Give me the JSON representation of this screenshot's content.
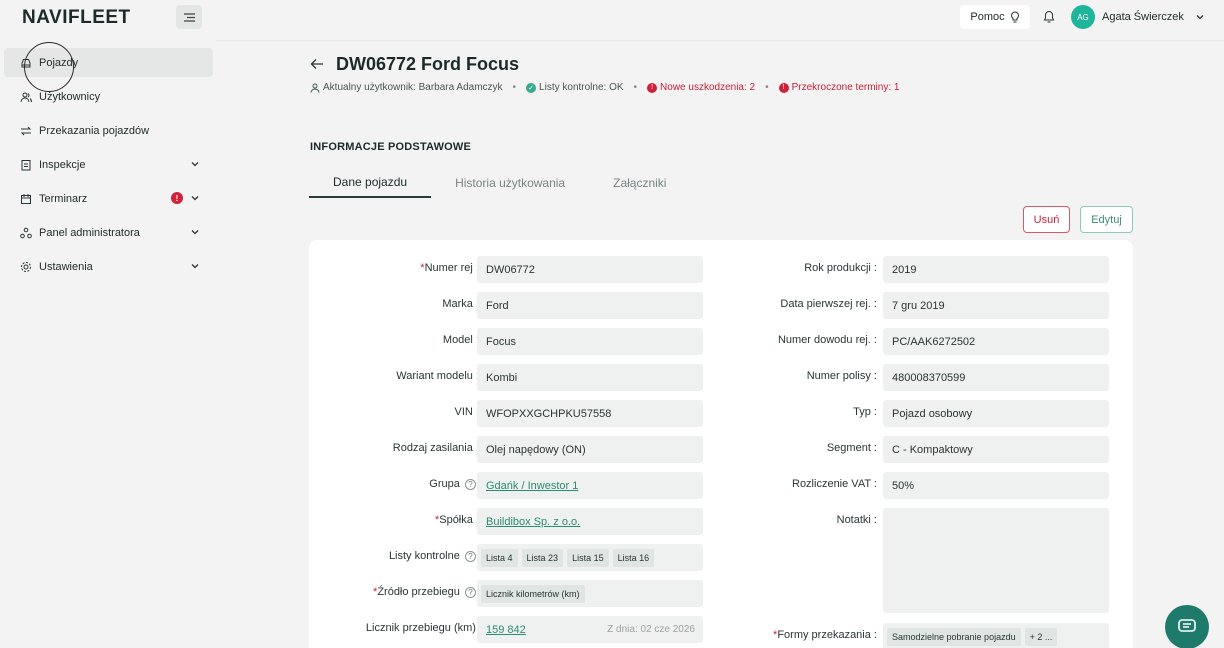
{
  "app": {
    "logo": "NAVIFLEET"
  },
  "sidebar": {
    "items": [
      {
        "label": "Pojazdy",
        "icon": "car-icon"
      },
      {
        "label": "Użytkownicy",
        "icon": "users-icon"
      },
      {
        "label": "Przekazania pojazdów",
        "icon": "swap-icon"
      },
      {
        "label": "Inspekcje",
        "icon": "clipboard-icon"
      },
      {
        "label": "Terminarz",
        "icon": "calendar-icon",
        "alert": "!"
      },
      {
        "label": "Panel administratora",
        "icon": "admin-icon"
      },
      {
        "label": "Ustawienia",
        "icon": "gear-icon"
      }
    ]
  },
  "topbar": {
    "help": "Pomoc",
    "user_initials": "AG",
    "user_name": "Agata Świerczek"
  },
  "header": {
    "title": "DW06772 Ford Focus",
    "current_user": "Aktualny użytkownik: Barbara Adamczyk",
    "checklists": "Listy kontrolne: OK",
    "damages": "Nowe uszkodzenia: 2",
    "overdue": "Przekroczone terminy: 1"
  },
  "section": {
    "title": "INFORMACJE PODSTAWOWE"
  },
  "tabs": [
    "Dane pojazdu",
    "Historia użytkowania",
    "Załączniki"
  ],
  "actions": {
    "delete": "Usuń",
    "edit": "Edytuj"
  },
  "form": {
    "left": [
      {
        "label": "Numer rej",
        "value": "DW06772"
      },
      {
        "label": "Marka",
        "value": "Ford"
      },
      {
        "label": "Model",
        "value": "Focus"
      },
      {
        "label": "Wariant modelu",
        "value": "Kombi"
      },
      {
        "label": "VIN",
        "value": "WFOPXXGCHPKU57558"
      },
      {
        "label": "Rodzaj zasilania",
        "value": "Olej napędowy (ON)"
      },
      {
        "label": "Grupa",
        "value": "Gdańk / Inwestor 1"
      },
      {
        "label": "Spółka",
        "value": "Buildibox Sp. z o.o."
      },
      {
        "label": "Listy kontrolne",
        "chips": [
          "Lista 4",
          "Lista 23",
          "Lista 15",
          "Lista 16"
        ]
      },
      {
        "label": "Źródło przebiegu",
        "chips": [
          "Licznik kilometrów (km)"
        ]
      },
      {
        "label": "Licznik przebiegu (km)",
        "value": "159 842",
        "note": "Z dnia: 02 cze 2026"
      }
    ],
    "right": [
      {
        "label": "Rok produkcji",
        "value": "2019"
      },
      {
        "label": "Data pierwszej rej.",
        "value": "7 gru 2019"
      },
      {
        "label": "Numer dowodu rej.",
        "value": "PC/AAK6272502"
      },
      {
        "label": "Numer polisy",
        "value": "480008370599"
      },
      {
        "label": "Typ",
        "value": "Pojazd osobowy"
      },
      {
        "label": "Segment",
        "value": "C - Kompaktowy"
      },
      {
        "label": "Rozliczenie VAT",
        "value": "50%"
      },
      {
        "label": "Notatki",
        "value": ""
      },
      {
        "label": "Formy przekazania",
        "chips": [
          "Samodzielne pobranie pojazdu",
          "+ 2 ..."
        ]
      }
    ]
  }
}
